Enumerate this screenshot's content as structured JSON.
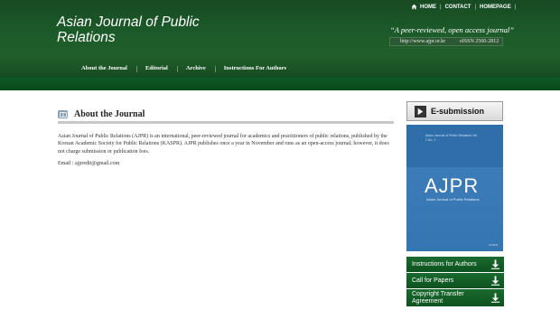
{
  "header": {
    "title": "Asian Journal of Public Relations",
    "tagline": "“A peer-reviewed, open access journal”",
    "url": "http://www.ajpr.or.kr",
    "issn": "eISSN 2560-2812"
  },
  "topnav": {
    "home": "HOME",
    "contact": "CONTACT",
    "homepage": "HOMEPAGE",
    "separator": "|"
  },
  "mainnav": [
    {
      "label": "About the Journal"
    },
    {
      "label": "Editorial"
    },
    {
      "label": "Archive"
    },
    {
      "label": "Instructions For Authors"
    }
  ],
  "about": {
    "heading": "About the Journal",
    "description": "Asian Journal of Public Relations (AJPR) is an international, peer-reviewed journal for academics and practitioners of public relations, published by the Korean Academic Society for Public Relations (KASPR). AJPR publishes once a year in November and runs as an open-access journal; however, it does not charge submission or publication fees.",
    "email": "Email : ajpredit@gmail.com"
  },
  "sidebar": {
    "esubmission": "E-submission",
    "cover": {
      "small_text": "Asian Journal of Public Relations Vol. 1 No. 1",
      "abbrev": "AJPR",
      "subtitle": "Asian Journal of Public Relations",
      "footer": "KASPR"
    },
    "downloads": [
      {
        "label": "Instructions for Authors"
      },
      {
        "label": "Call for Papers"
      },
      {
        "label": "Copyright Transfer Agreement"
      }
    ]
  },
  "colors": {
    "header_green": "#1d5c2a",
    "download_green": "#14602a",
    "cover_blue": "#3a7ab6"
  },
  "icons": {
    "home": "home-icon",
    "about": "book-icon",
    "esubmission": "arrow-right-icon",
    "download": "download-icon"
  }
}
